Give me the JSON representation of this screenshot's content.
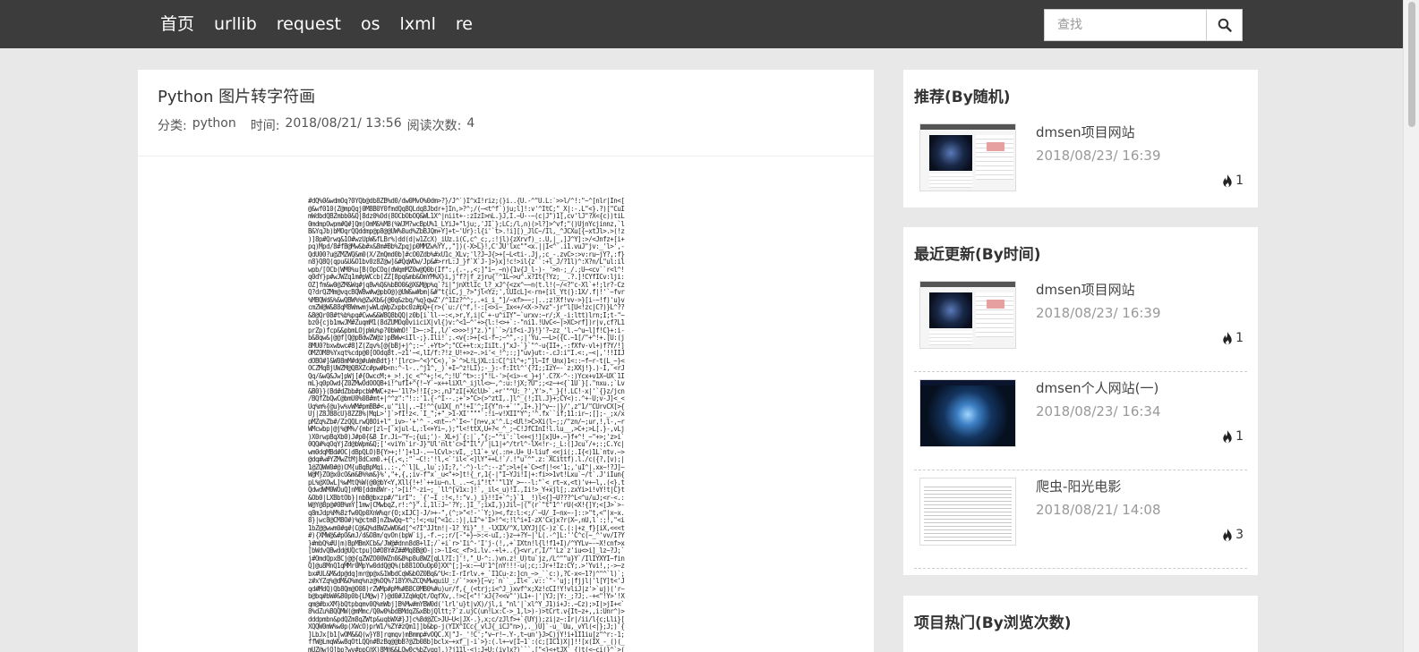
{
  "nav": {
    "items": [
      "首页",
      "urllib",
      "request",
      "os",
      "lxml",
      "re"
    ],
    "search_placeholder": "查找"
  },
  "article": {
    "title": "Python 图片转字符画",
    "category_label": "分类:",
    "category": "python",
    "time_label": "时间:",
    "time": "2018/08/21/ 13:56",
    "views_label": "阅读次数:",
    "views": "4"
  },
  "recommend": {
    "title": "推荐(By随机)",
    "items": [
      {
        "title": "dmsen项目网站",
        "date": "2018/08/23/ 16:39",
        "views": "1"
      }
    ]
  },
  "recent": {
    "title": "最近更新(By时间)",
    "items": [
      {
        "title": "dmsen项目网站",
        "date": "2018/08/23/ 16:39",
        "views": "1"
      },
      {
        "title": "dmsen个人网站(一)",
        "date": "2018/08/23/ 16:34",
        "views": "1"
      },
      {
        "title": "爬虫-阳光电影",
        "date": "2018/08/21/ 14:08",
        "views": "3"
      }
    ]
  },
  "hot": {
    "title": "项目热门(By浏览次数)"
  },
  "icons": {
    "search": "search-icon",
    "views": "fire-icon"
  }
}
